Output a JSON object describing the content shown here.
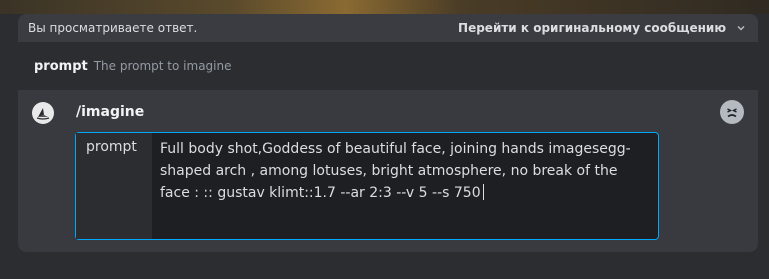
{
  "reply_bar": {
    "viewing_text": "Вы просматриваете ответ.",
    "jump_text": "Перейти к оригинальному сообщению"
  },
  "option_hint": {
    "name": "prompt",
    "description": "The prompt to imagine"
  },
  "command": {
    "name": "/imagine",
    "field_label": "prompt",
    "field_value": "Full body shot,Goddess of beautiful face, joining hands imagesegg-shaped arch , among lotuses, bright atmosphere, no break of the face : :: gustav klimt::1.7 --ar 2:3 --v 5 --s 750"
  },
  "icons": {
    "chevron": "chevron-down-icon",
    "bot_avatar": "bot-avatar-icon",
    "emoji": "emoji-icon"
  },
  "colors": {
    "accent": "#00a8fc",
    "panel": "#383a40",
    "background": "#2b2d31"
  }
}
